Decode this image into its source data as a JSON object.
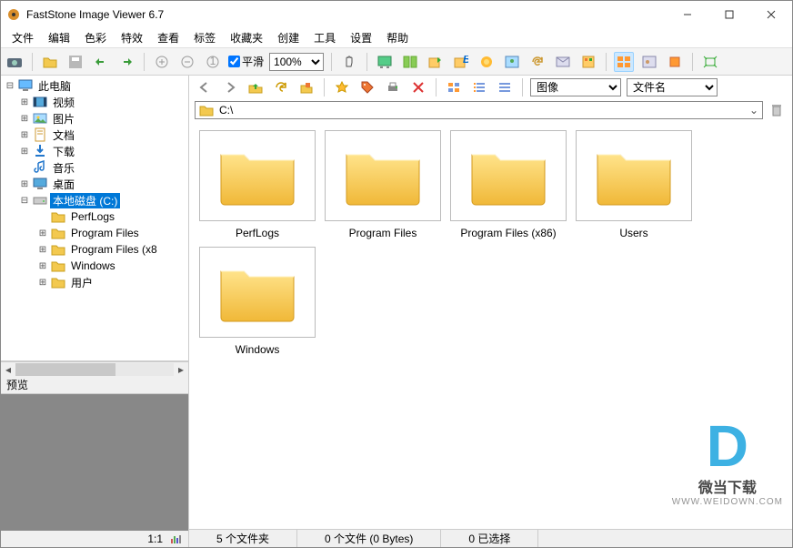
{
  "title": "FastStone Image Viewer 6.7",
  "menus": [
    "文件",
    "编辑",
    "色彩",
    "特效",
    "查看",
    "标签",
    "收藏夹",
    "创建",
    "工具",
    "设置",
    "帮助"
  ],
  "smooth_label": "平滑",
  "zoom_value": "100%",
  "toolbar2": {
    "sort1_label": "图像",
    "sort2_label": "文件名"
  },
  "path": "C:\\",
  "tree": {
    "root": "此电脑",
    "items": [
      {
        "icon": "video",
        "label": "视频",
        "exp": "+"
      },
      {
        "icon": "picture",
        "label": "图片",
        "exp": "+"
      },
      {
        "icon": "doc",
        "label": "文档",
        "exp": "+"
      },
      {
        "icon": "download",
        "label": "下载",
        "exp": "+"
      },
      {
        "icon": "music",
        "label": "音乐",
        "exp": ""
      },
      {
        "icon": "desktop",
        "label": "桌面",
        "exp": "+"
      }
    ],
    "drive": {
      "label": "本地磁盘 (C:)",
      "exp": "-"
    },
    "drive_children": [
      {
        "label": "PerfLogs",
        "exp": ""
      },
      {
        "label": "Program Files",
        "exp": "+"
      },
      {
        "label": "Program Files (x8",
        "exp": "+"
      },
      {
        "label": "Windows",
        "exp": "+"
      },
      {
        "label": "用户",
        "exp": "+"
      }
    ]
  },
  "preview_header": "预览",
  "preview_ratio": "1:1",
  "folders": [
    "PerfLogs",
    "Program Files",
    "Program Files (x86)",
    "Users",
    "Windows"
  ],
  "status": {
    "folders": "5 个文件夹",
    "files": "0 个文件 (0 Bytes)",
    "selected": "0 已选择"
  },
  "watermark": {
    "line1": "微当下载",
    "line2": "WWW.WEIDOWN.COM"
  }
}
